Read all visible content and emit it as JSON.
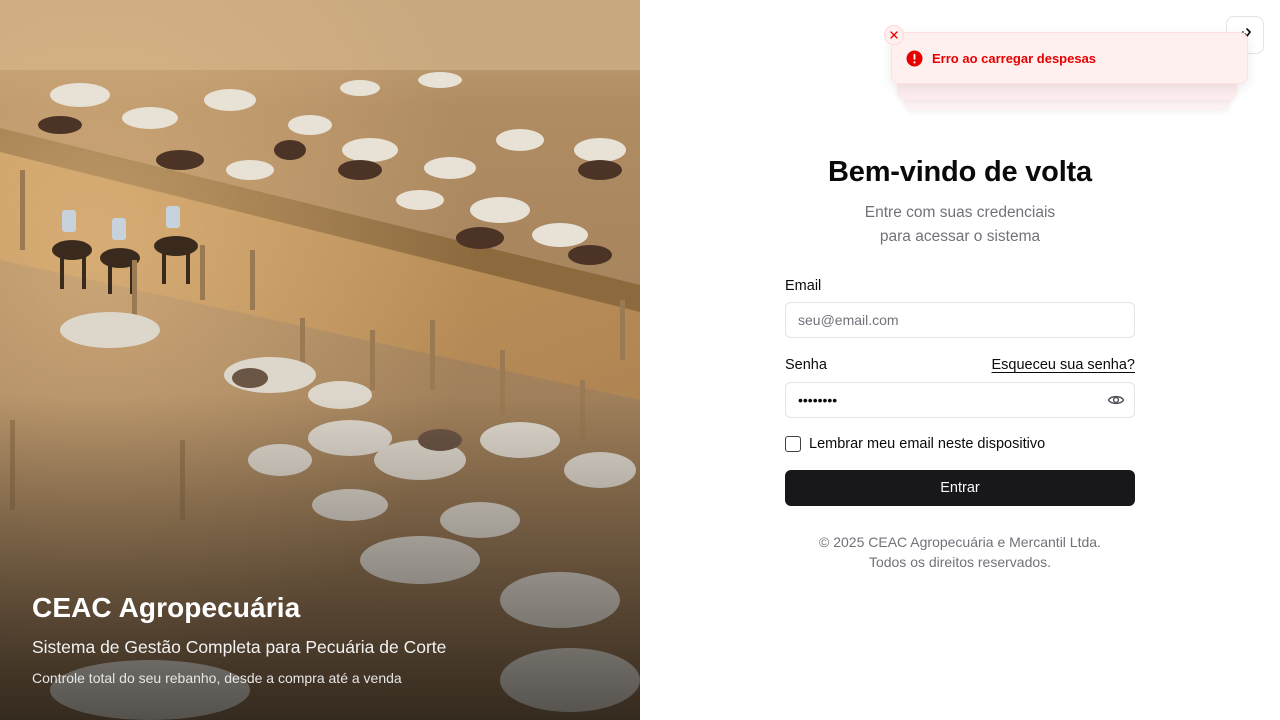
{
  "hero": {
    "title": "CEAC Agropecuária",
    "subtitle": "Sistema de Gestão Completa para Pecuária de Corte",
    "tagline": "Controle total do seu rebanho, desde a compra até a venda"
  },
  "toast": {
    "message": "Erro ao carregar despesas",
    "icon": "alert-circle-icon",
    "color": "#e60000"
  },
  "login": {
    "title": "Bem-vindo de volta",
    "intro_line1": "Entre com suas credenciais",
    "intro_line2": "para acessar o sistema",
    "email_label": "Email",
    "email_placeholder": "seu@email.com",
    "password_label": "Senha",
    "forgot_label": "Esqueceu sua senha?",
    "password_value": "••••••••",
    "remember_label": "Lembrar meu email neste dispositivo",
    "submit_label": "Entrar"
  },
  "footer": {
    "line1": "© 2025 CEAC Agropecuária e Mercantil Ltda.",
    "line2": "Todos os direitos reservados."
  },
  "colors": {
    "primary_button": "#18181b",
    "muted_text": "#71717a",
    "error": "#e60000"
  }
}
